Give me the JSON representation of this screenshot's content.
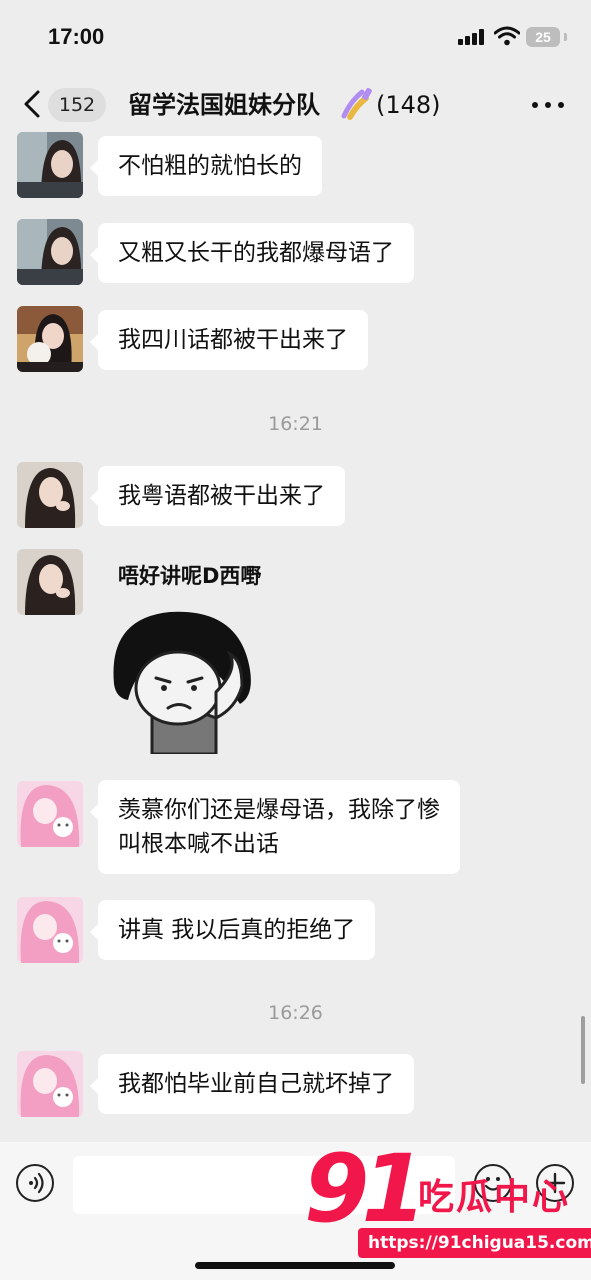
{
  "status_bar": {
    "time": "17:00",
    "battery": "25"
  },
  "header": {
    "unread_count": "152",
    "title": "留学法国姐妹分队",
    "title_emoji": "nail-polish-emoji",
    "member_count": "(148)"
  },
  "messages": [
    {
      "type": "text",
      "avatar": "avatar-1",
      "text": "不怕粗的就怕长的"
    },
    {
      "type": "text",
      "avatar": "avatar-1",
      "text": "又粗又长干的我都爆母语了"
    },
    {
      "type": "text",
      "avatar": "avatar-2",
      "text": "我四川话都被干出来了"
    },
    {
      "type": "time",
      "text": "16:21"
    },
    {
      "type": "text",
      "avatar": "avatar-3",
      "text": "我粤语都被干出来了"
    },
    {
      "type": "sticker",
      "avatar": "avatar-3",
      "caption": "唔好讲呢D西嘢"
    },
    {
      "type": "text",
      "avatar": "avatar-4",
      "lines": [
        "羡慕你们还是爆母语，我除了惨",
        "叫根本喊不出话"
      ]
    },
    {
      "type": "text",
      "avatar": "avatar-4",
      "text": "讲真 我以后真的拒绝了"
    },
    {
      "type": "time",
      "text": "16:26"
    },
    {
      "type": "text",
      "avatar": "avatar-4",
      "text": "我都怕毕业前自己就坏掉了"
    }
  ],
  "input": {
    "placeholder": ""
  },
  "watermark": {
    "digits": "91",
    "text": "吃瓜中心",
    "url": "https://91chigua15.com"
  },
  "colors": {
    "background": "#ededed",
    "bubble": "#ffffff",
    "watermark": "#f2174a"
  }
}
